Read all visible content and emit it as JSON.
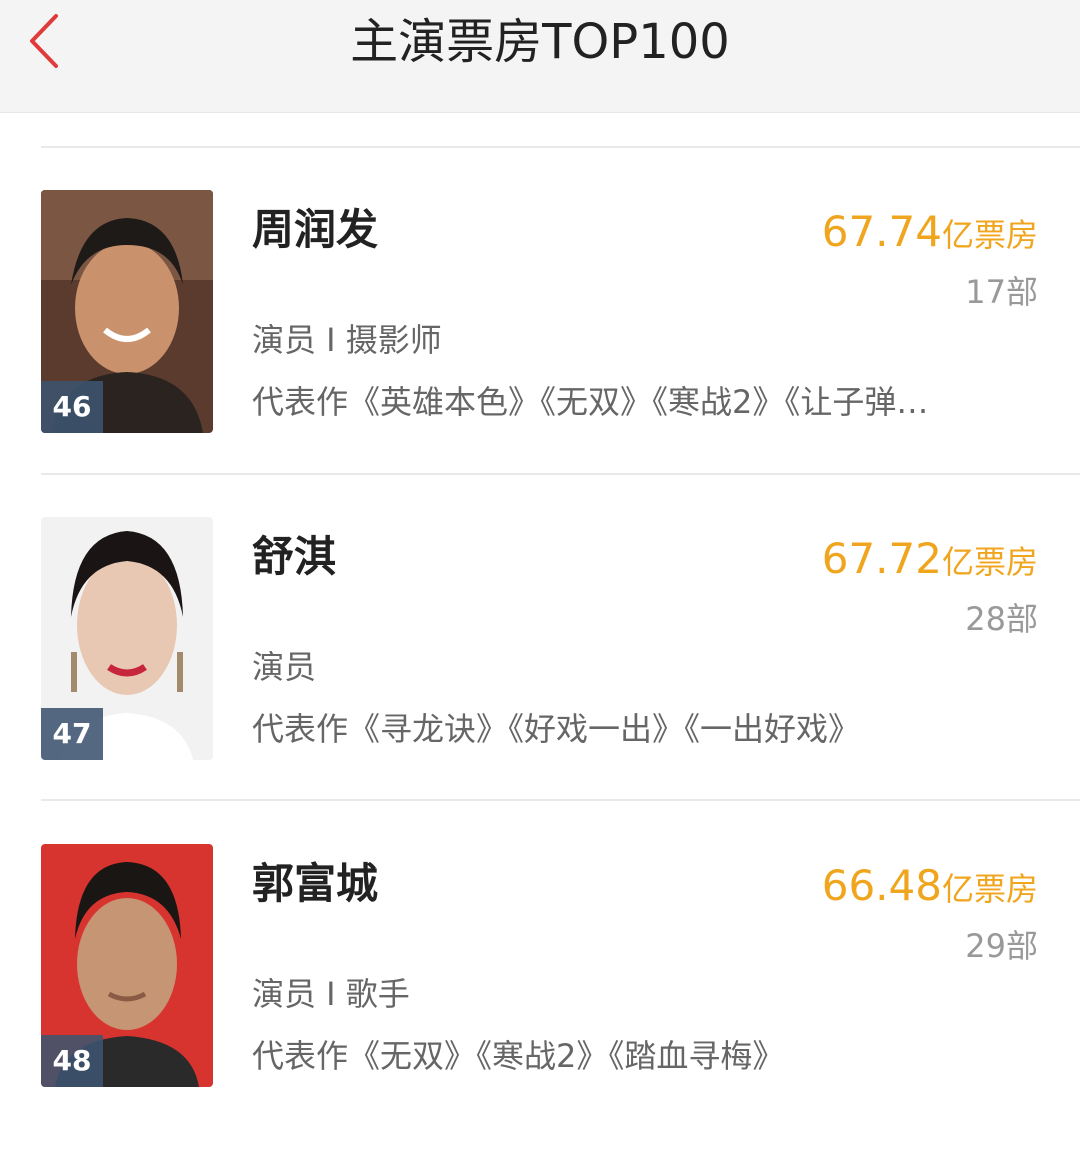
{
  "header": {
    "title": "主演票房TOP100"
  },
  "actors": [
    {
      "rank": "46",
      "name": "周润发",
      "box_value": "67.74",
      "box_unit": "亿票房",
      "count": "17部",
      "roles": "演员 I 摄影师",
      "works": "代表作《英雄本色》《无双》《寒战2》《让子弹…"
    },
    {
      "rank": "47",
      "name": "舒淇",
      "box_value": "67.72",
      "box_unit": "亿票房",
      "count": "28部",
      "roles": "演员",
      "works": "代表作《寻龙诀》《好戏一出》《一出好戏》"
    },
    {
      "rank": "48",
      "name": "郭富城",
      "box_value": "66.48",
      "box_unit": "亿票房",
      "count": "29部",
      "roles": "演员 I 歌手",
      "works": "代表作《无双》《寒战2》《踏血寻梅》"
    }
  ],
  "colors": {
    "accent": "#f0a51e",
    "back_arrow": "#e03a3a"
  }
}
